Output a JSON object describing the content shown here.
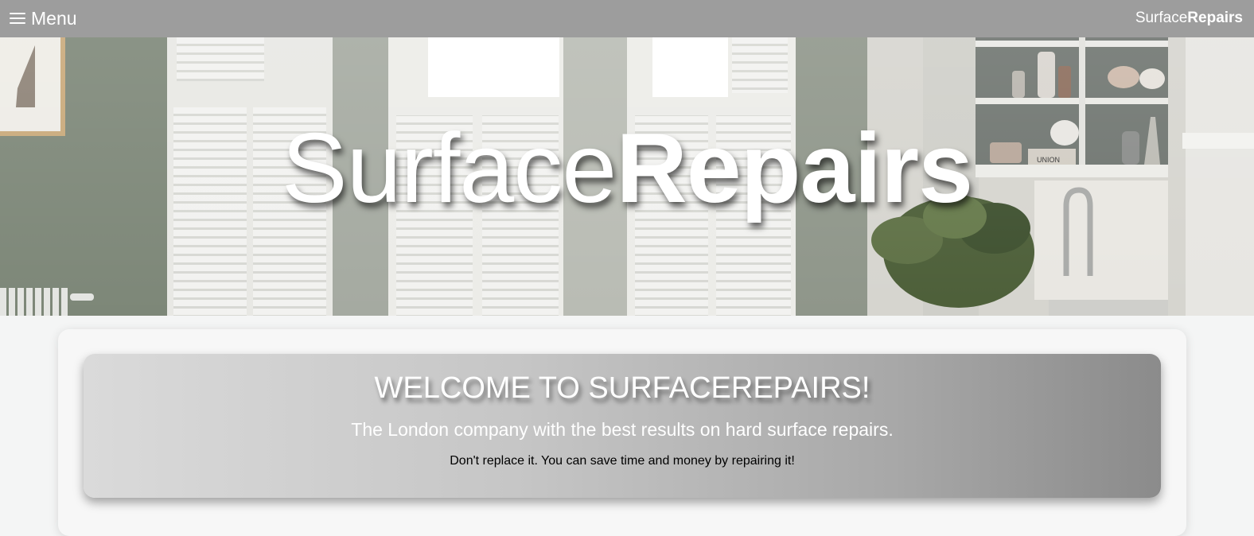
{
  "topbar": {
    "menu_label": "Menu",
    "brand_regular": "Surface",
    "brand_bold": "Repairs"
  },
  "hero": {
    "title_regular": "Surface",
    "title_bold": "Repairs",
    "shelf_box_label": "UNION"
  },
  "welcome": {
    "title": "WELCOME TO SURFACEREPAIRS!",
    "subtitle": "The London company with the best results on hard surface repairs.",
    "note": "Don't replace it. You can save time and money by repairing it!"
  },
  "colors": {
    "topbar": "#9d9d9d",
    "page_background": "#f4f5f5",
    "card_background": "#f7f7f7",
    "welcome_gradient_start": "#dadada",
    "welcome_gradient_end": "#8b8b8b",
    "hero_text": "#ffffff"
  },
  "icons": {
    "menu": "hamburger-icon"
  }
}
